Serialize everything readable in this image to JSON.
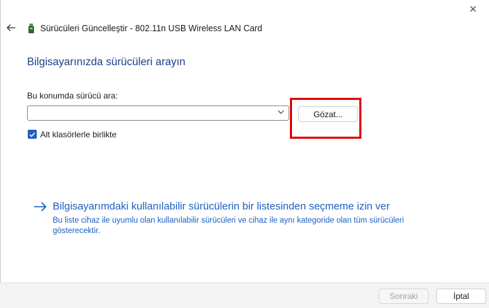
{
  "window": {
    "title": "Sürücüleri Güncelleştir - 802.11n USB Wireless LAN Card",
    "close_glyph": "✕",
    "icons": {
      "back": "back-arrow-icon",
      "device": "usb-device-icon",
      "close": "close-icon"
    }
  },
  "main": {
    "heading": "Bilgisayarınızda sürücüleri arayın",
    "location_label": "Bu konumda sürücü ara:",
    "path_value": "",
    "browse_label": "Gözat...",
    "include_subfolders_label": "Alt klasörlerle birlikte",
    "include_subfolders_checked": true
  },
  "pick_option": {
    "link_text": "Bilgisayarımdaki kullanılabilir sürücülerin bir listesinden seçmeme izin ver",
    "description": "Bu liste cihaz ile uyumlu olan kullanılabilir sürücüleri ve cihaz ile aynı kategoride olan tüm sürücüleri gösterecektir."
  },
  "footer": {
    "next_label": "Sonraki",
    "cancel_label": "İptal"
  },
  "colors": {
    "heading": "#1c3e8a",
    "link": "#1c5fc0",
    "checkbox": "#1f5fbf",
    "highlight": "#e00000"
  }
}
